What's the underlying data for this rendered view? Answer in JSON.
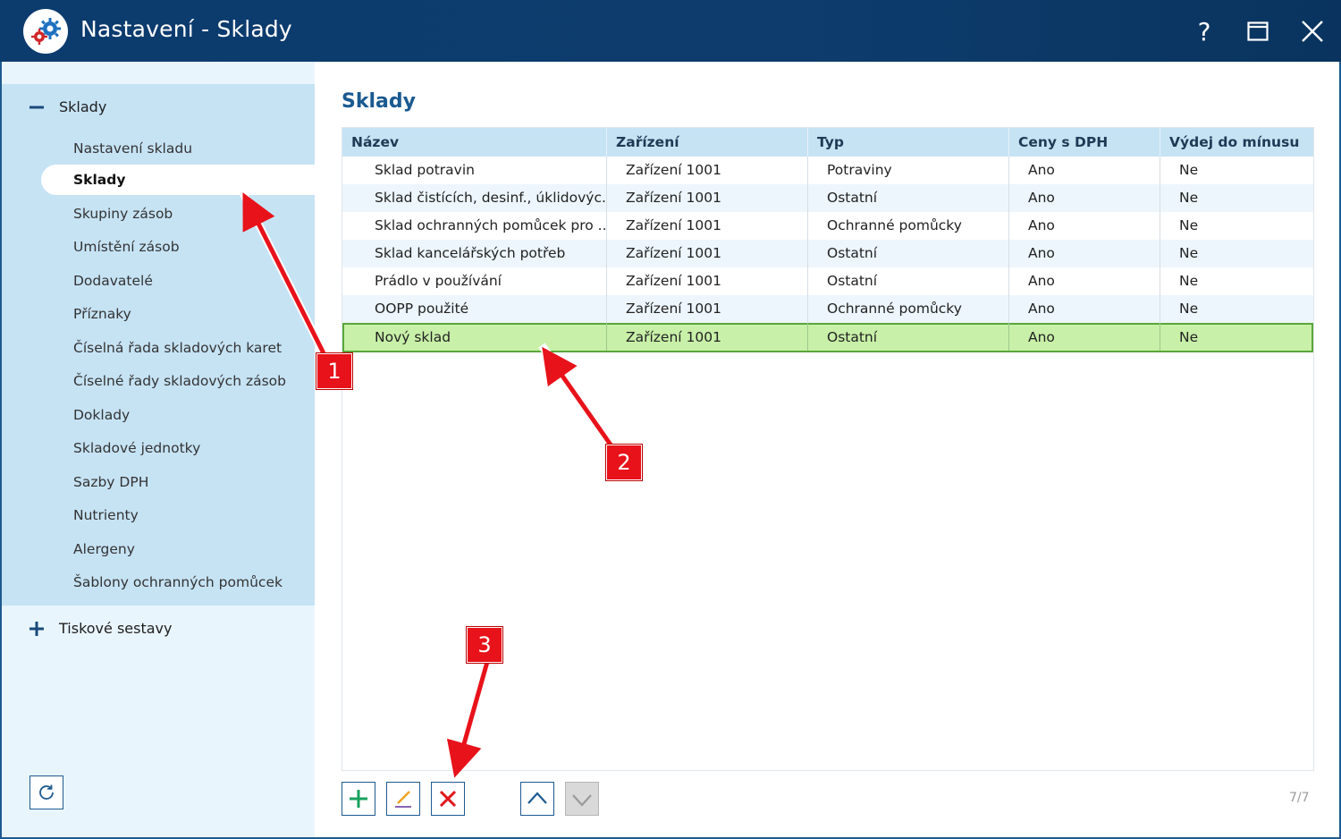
{
  "window": {
    "title": "Nastavení - Sklady",
    "help_label": "?"
  },
  "sidebar": {
    "group": "Sklady",
    "items": [
      {
        "label": "Nastavení skladu"
      },
      {
        "label": "Sklady"
      },
      {
        "label": "Skupiny zásob"
      },
      {
        "label": "Umístění zásob"
      },
      {
        "label": "Dodavatelé"
      },
      {
        "label": "Příznaky"
      },
      {
        "label": "Číselná řada skladových karet"
      },
      {
        "label": "Číselné řady skladových zásob"
      },
      {
        "label": "Doklady"
      },
      {
        "label": "Skladové jednotky"
      },
      {
        "label": "Sazby DPH"
      },
      {
        "label": "Nutrienty"
      },
      {
        "label": "Alergeny"
      },
      {
        "label": "Šablony ochranných pomůcek"
      }
    ],
    "active_item": "Sklady",
    "group2": "Tiskové sestavy"
  },
  "main": {
    "title": "Sklady",
    "columns": [
      "Název",
      "Zařízení",
      "Typ",
      "Ceny s DPH",
      "Výdej do mínusu"
    ],
    "rows": [
      [
        "Sklad potravin",
        "Zařízení 1001",
        "Potraviny",
        "Ano",
        "Ne"
      ],
      [
        "Sklad čistících, desinf., úklidovýc...",
        "Zařízení 1001",
        "Ostatní",
        "Ano",
        "Ne"
      ],
      [
        "Sklad ochranných pomůcek pro ...",
        "Zařízení 1001",
        "Ochranné pomůcky",
        "Ano",
        "Ne"
      ],
      [
        "Sklad kancelářských potřeb",
        "Zařízení 1001",
        "Ostatní",
        "Ano",
        "Ne"
      ],
      [
        "Prádlo v používání",
        "Zařízení 1001",
        "Ostatní",
        "Ano",
        "Ne"
      ],
      [
        "OOPP použité",
        "Zařízení 1001",
        "Ochranné pomůcky",
        "Ano",
        "Ne"
      ],
      [
        "Nový sklad",
        "Zařízení 1001",
        "Ostatní",
        "Ano",
        "Ne"
      ]
    ],
    "selected_row": "Nový sklad",
    "pager": "7/7"
  },
  "annotations": [
    "1",
    "2",
    "3"
  ],
  "colors": {
    "titlebar": "#0c3b6e",
    "sidebar_group": "#c6e3f4",
    "header_row": "#c6e3f4",
    "selected_row": "#c8f0a8",
    "selected_border": "#5aa63a",
    "add_icon": "#18a05e",
    "delete_icon": "#e0151c",
    "callout": "#e8121a"
  }
}
